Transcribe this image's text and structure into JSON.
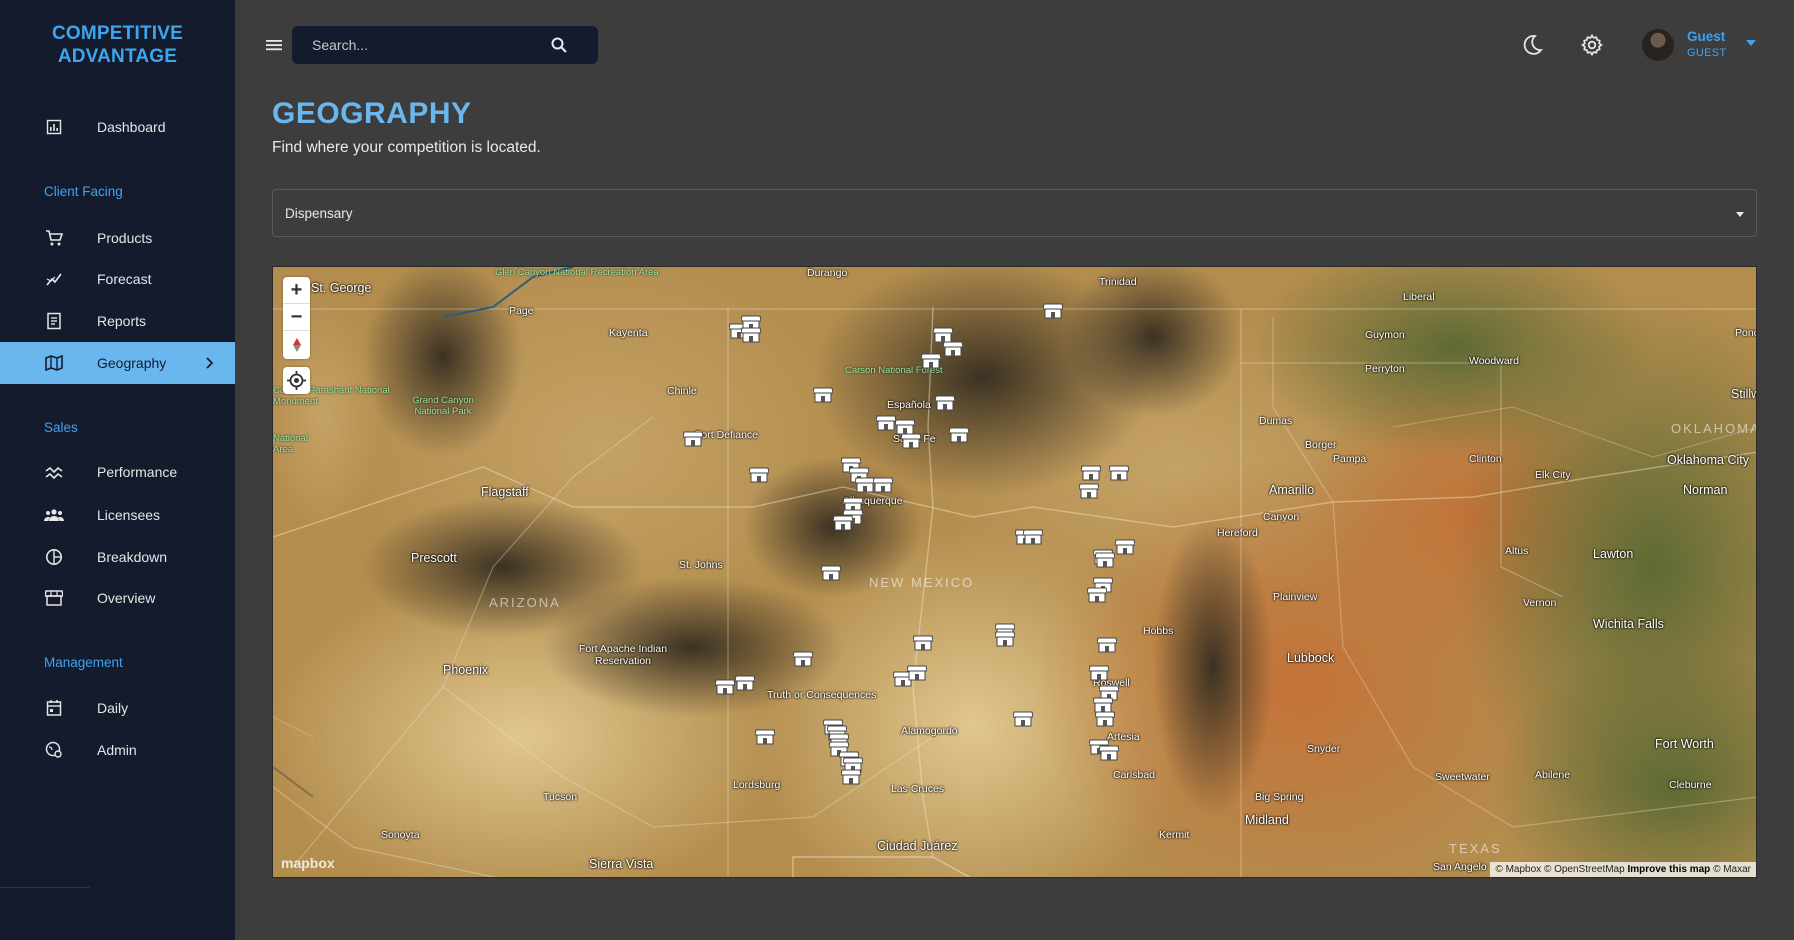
{
  "brand": {
    "line1": "COMPETITIVE",
    "line2": "ADVANTAGE"
  },
  "sidebar": {
    "dashboard": "Dashboard",
    "sections": {
      "client": "Client Facing",
      "sales": "Sales",
      "management": "Management"
    },
    "items": {
      "products": "Products",
      "forecast": "Forecast",
      "reports": "Reports",
      "geography": "Geography",
      "performance": "Performance",
      "licensees": "Licensees",
      "breakdown": "Breakdown",
      "overview": "Overview",
      "daily": "Daily",
      "admin": "Admin"
    },
    "active": "geography"
  },
  "topbar": {
    "search_placeholder": "Search...",
    "user_name": "Guest",
    "user_role": "GUEST"
  },
  "header": {
    "title": "GEOGRAPHY",
    "subtitle": "Find where your competition is located."
  },
  "filter": {
    "selected": "Dispensary"
  },
  "map": {
    "controls": {
      "zoom_in": "+",
      "zoom_out": "−"
    },
    "logo": "mapbox",
    "attribution": {
      "text": "© Mapbox © OpenStreetMap",
      "link": "Improve this map",
      "suffix": "© Maxar"
    },
    "labels": [
      "St. George",
      "Glen Canyon National Recreation Area",
      "Durango",
      "Trinidad",
      "Liberal",
      "Page",
      "Kayenta",
      "Chinle",
      "Fort Defiance",
      "Flagstaff",
      "Prescott",
      "ARIZONA",
      "Phoenix",
      "Tucson",
      "Sierra Vista",
      "Sonoyta",
      "St. Johns",
      "Fort Apache Indian Reservation",
      "Santa Fe",
      "Española",
      "Albuquerque",
      "NEW MEXICO",
      "Truth or Consequences",
      "Alamogordo",
      "Las Cruces",
      "Ciudad Juárez",
      "Lordsburg",
      "Roswell",
      "Artesia",
      "Carlsbad",
      "Hobbs",
      "Amarillo",
      "Dumas",
      "Borger",
      "Pampa",
      "Canyon",
      "Hereford",
      "Plainview",
      "Lubbock",
      "Snyder",
      "Big Spring",
      "Midland",
      "Kermit",
      "Guymon",
      "Perryton",
      "Woodward",
      "Elk City",
      "Clinton",
      "Altus",
      "Vernon",
      "Lawton",
      "Wichita Falls",
      "Oklahoma City",
      "Norman",
      "OKLAHOMA",
      "Stillwater",
      "Ponca City",
      "Fort Worth",
      "Abilene",
      "Sweetwater",
      "Cleburne",
      "TEXAS",
      "San Angelo",
      "Carson National Forest",
      "Grand Canyon National Park",
      "Canyon-Parashant National Monument",
      "National Area"
    ]
  }
}
